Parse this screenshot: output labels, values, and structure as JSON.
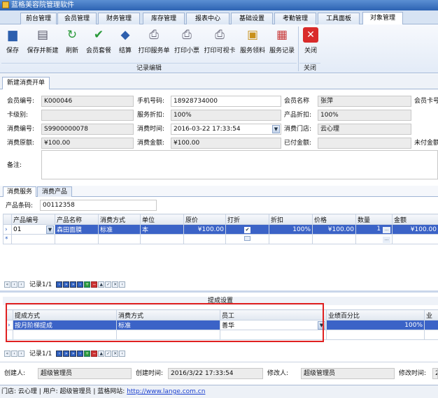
{
  "window": {
    "title": "蓝格美容院管理软件"
  },
  "menu_tabs": [
    "前台管理",
    "会员管理",
    "财务管理",
    "库存管理",
    "报表中心",
    "基础设置",
    "考勤管理",
    "工具面板",
    "对象管理"
  ],
  "ribbon": {
    "buttons": [
      "保存",
      "保存并新建",
      "刷新",
      "会员套餐",
      "结算",
      "打印服务单",
      "打印小票",
      "打印可视卡",
      "服务领料",
      "服务记录",
      "关闭"
    ],
    "groups": [
      "记录编辑",
      "关闭"
    ]
  },
  "doc_tab": "新建消费开单",
  "form": {
    "member_no_label": "会员编号:",
    "member_no": "K000046",
    "phone_label": "手机号码:",
    "phone": "18928734000",
    "member_name_label": "会员名称",
    "member_name": "张萍",
    "member_card_label": "会员卡号",
    "card_level_label": "卡级别:",
    "card_level": "",
    "service_discount_label": "服务折扣:",
    "service_discount": "100%",
    "product_discount_label": "产品折扣:",
    "product_discount": "100%",
    "consume_no_label": "消费编号:",
    "consume_no": "S9900000078",
    "consume_time_label": "消费时间:",
    "consume_time": "2016-03-22 17:33:54",
    "store_label": "消费门店:",
    "store": "云心理",
    "original_amount_label": "消费原额:",
    "original_amount": "¥100.00",
    "amount_label": "消费金额:",
    "amount": "¥100.00",
    "paid_label": "已付金额:",
    "paid": "",
    "unpaid_label": "未付金额",
    "remark_label": "备注:"
  },
  "sub_tabs": [
    "消费服务",
    "消费产品"
  ],
  "product_barcode_label": "产品条码:",
  "product_barcode": "00112358",
  "products_grid": {
    "headers": [
      "产品编号",
      "产品名称",
      "消费方式",
      "单位",
      "原价",
      "打折",
      "折扣",
      "价格",
      "数量",
      "金额"
    ],
    "rows": [
      [
        "01",
        "森田面膜",
        "标准",
        "本",
        "¥100.00",
        "",
        "100%",
        "¥100.00",
        "1",
        "¥100.00"
      ]
    ]
  },
  "nav1": {
    "record": "记录1/1"
  },
  "commission": {
    "title": "提成设置",
    "headers": [
      "提成方式",
      "消费方式",
      "员工",
      "业绩百分比",
      "业"
    ],
    "rows": [
      [
        "按月阶梯提成",
        "标准",
        "善华",
        "100%"
      ]
    ]
  },
  "nav2": {
    "record": "记录1/1"
  },
  "footer": {
    "creator_label": "创建人:",
    "creator": "超级管理员",
    "created_label": "创建时间:",
    "created": "2016/3/22 17:33:54",
    "modifier_label": "修改人:",
    "modifier": "超级管理员",
    "modified_label": "修改时间:",
    "modified": "2"
  },
  "status": {
    "text": "门店: 云心理 | 用户: 超级管理员 | 蓝格网站:",
    "link": "http://www.lange.com.cn"
  },
  "colors": {
    "accent": "#2c62b3",
    "selection": "#3b63c7",
    "highlight_border": "#e02020"
  }
}
